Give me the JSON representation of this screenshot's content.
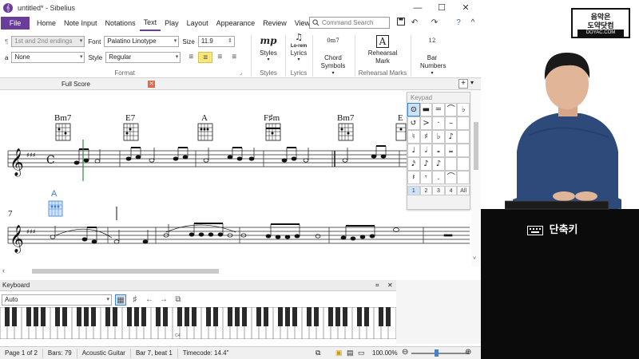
{
  "window": {
    "title": "untitled* - Sibelius",
    "app_icon_glyph": "𝄞",
    "minimize_glyph": "—",
    "maximize_glyph": "☐",
    "close_glyph": "✕"
  },
  "menu": {
    "file": "File",
    "tabs": [
      "Home",
      "Note Input",
      "Notations",
      "Text",
      "Play",
      "Layout",
      "Appearance",
      "Review",
      "View"
    ],
    "active_tab": "Text",
    "search_placeholder": "Command Search",
    "quick_access": [
      "save-icon",
      "undo-icon",
      "redo-icon",
      "help-icon"
    ]
  },
  "ribbon": {
    "row1_para_icon": "¶",
    "style_dropdown": "1st and 2nd endings",
    "font_label": "Font",
    "font_value": "Palatino Linotype",
    "size_label": "Size",
    "size_value": "11.9",
    "row2_char_icon": "a",
    "char_dropdown": "None",
    "style_label": "Style",
    "style_value": "Regular",
    "align_buttons": [
      "align-left",
      "align-center",
      "align-right",
      "justify"
    ],
    "align_selected": "align-center",
    "format_group": "Format",
    "styles_button": "Styles",
    "styles_group": "Styles",
    "lyrics_button": "Lyrics",
    "lyrics_group": "Lyrics",
    "chord_symbols_button": "Chord Symbols",
    "rehearsal_button": "Rehearsal Mark",
    "rehearsal_group": "Rehearsal Marks",
    "bar_numbers_button": "Bar Numbers",
    "styles_icon_text": "mp",
    "lyrics_icon_text": "Lo-rem",
    "chord_icon_text": "0m7",
    "rehearsal_icon_text": "A",
    "bar_numbers_icon_text": "12"
  },
  "score_tab": {
    "label": "Full Score"
  },
  "score": {
    "chords_row1": [
      "Bm7",
      "E7",
      "A",
      "F♯m",
      "Bm7",
      "E"
    ],
    "rehearsal_row2": "A",
    "bar_number": "7",
    "time_signature": "C"
  },
  "keypad": {
    "title": "Keypad",
    "tabs": [
      "1",
      "2",
      "3",
      "4",
      "All"
    ]
  },
  "keyboard_panel": {
    "title": "Keyboard",
    "mode": "Auto",
    "c4_label": "C4"
  },
  "status": {
    "page": "Page 1 of 2",
    "bars": "Bars: 79",
    "instrument": "Acoustic Guitar",
    "position": "Bar 7, beat 1",
    "timecode": "Timecode: 14.4\"",
    "zoom": "100.00%"
  },
  "video": {
    "logo_line1": "음악은",
    "logo_line2": "도약닷컴",
    "logo_url": "DOYAC.COM",
    "shortcut_label": "단축키"
  }
}
